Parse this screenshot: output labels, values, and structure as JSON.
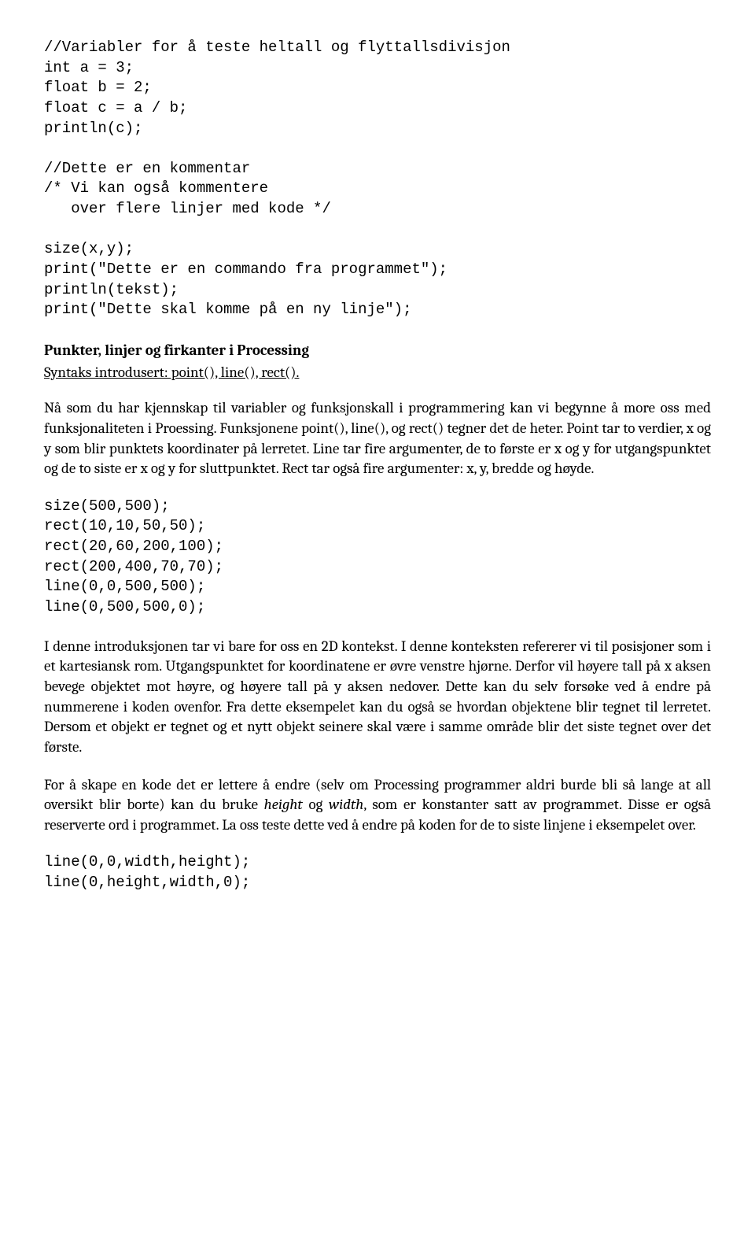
{
  "code1": "//Variabler for å teste heltall og flyttallsdivisjon\nint a = 3;\nfloat b = 2;\nfloat c = a / b;\nprintln(c);\n\n//Dette er en kommentar\n/* Vi kan også kommentere\n   over flere linjer med kode */\n\nsize(x,y);\nprint(\"Dette er en commando fra programmet\");\nprintln(tekst);\nprint(\"Dette skal komme på en ny linje\");",
  "heading": "Punkter, linjer og firkanter i Processing",
  "sub": "Syntaks introdusert: point(), line(),  rect().",
  "para1": "Nå som du har kjennskap til variabler og funksjonskall i programmering kan vi begynne å more oss med funksjonaliteten i Proessing. Funksjonene point(), line(), og rect() tegner det de heter. Point tar to verdier, x og y som blir punktets koordinater på lerretet.  Line tar fire argumenter, de to første er x og y for utgangspunktet og de to siste er x og y for sluttpunktet. Rect tar også fire argumenter: x, y, bredde og høyde.",
  "code2": "size(500,500);\nrect(10,10,50,50);\nrect(20,60,200,100);\nrect(200,400,70,70);\nline(0,0,500,500);\nline(0,500,500,0);",
  "para2": "I denne introduksjonen tar vi bare for oss en 2D kontekst. I denne konteksten refererer vi til posisjoner som i et kartesiansk rom. Utgangspunktet for koordinatene er øvre venstre hjørne. Derfor vil høyere tall på x aksen bevege objektet mot høyre, og høyere tall på y aksen nedover. Dette kan du selv forsøke ved å endre på nummerene i koden ovenfor. Fra dette eksempelet kan du også se hvordan objektene blir tegnet til lerretet. Dersom et objekt er tegnet og et nytt objekt seinere skal være i samme område blir det siste tegnet over det første.",
  "para3_a": "For å skape en kode det er lettere å endre (selv om Processing programmer aldri burde bli så lange at all oversikt blir borte) kan du bruke ",
  "para3_h": "height",
  "para3_b": " og ",
  "para3_w": "width",
  "para3_c": ", som er konstanter satt av programmet. Disse er også reserverte ord i programmet. La oss teste dette ved å endre på koden for de to siste linjene i eksempelet over.",
  "code3": "line(0,0,width,height);\nline(0,height,width,0);"
}
